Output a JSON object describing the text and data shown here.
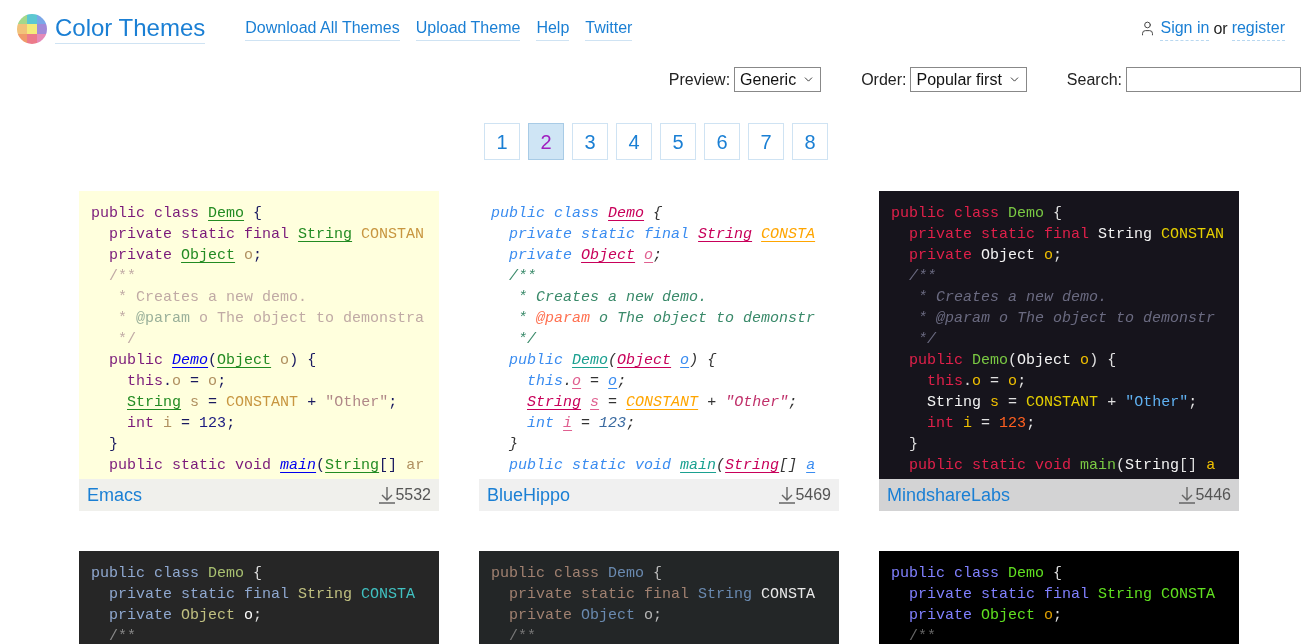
{
  "site": {
    "title": "Color Themes"
  },
  "nav": [
    "Download All Themes",
    "Upload Theme",
    "Help",
    "Twitter"
  ],
  "account": {
    "sign_in": "Sign in",
    "separator": "or",
    "register": "register"
  },
  "filters": [
    {
      "kind": "select",
      "label": "Preview:",
      "value": "Generic"
    },
    {
      "kind": "select",
      "label": "Order:",
      "value": "Popular first"
    },
    {
      "kind": "search",
      "label": "Search:"
    }
  ],
  "pages": [
    {
      "label": "1",
      "selected": false
    },
    {
      "label": "2",
      "selected": true
    },
    {
      "label": "3",
      "selected": false
    },
    {
      "label": "4",
      "selected": false
    },
    {
      "label": "5",
      "selected": false
    },
    {
      "label": "6",
      "selected": false
    },
    {
      "label": "7",
      "selected": false
    },
    {
      "label": "8",
      "selected": false
    }
  ],
  "cards": [
    {
      "kind": "emacs",
      "name": "Emacs",
      "downloads": "5532",
      "lines": [
        [
          {
            "text": "public class ",
            "kind": "kw"
          },
          {
            "text": "Demo",
            "kind": "cls"
          },
          {
            "text": " {",
            "kind": "punct"
          }
        ],
        [
          {
            "text": "  private static final ",
            "kind": "kw"
          },
          {
            "text": "String",
            "kind": "type"
          },
          {
            "text": " CONSTAN",
            "kind": "const"
          }
        ],
        [
          {
            "text": "  private ",
            "kind": "kw"
          },
          {
            "text": "Object",
            "kind": "type"
          },
          {
            "text": " o",
            "kind": "var"
          },
          {
            "text": ";",
            "kind": "punct"
          }
        ],
        [
          {
            "text": "  /**",
            "kind": "comment"
          }
        ],
        [
          {
            "text": "   * Creates a new demo.",
            "kind": "comment"
          }
        ],
        [
          {
            "text": "   * ",
            "kind": "comment"
          },
          {
            "text": "@param",
            "kind": "tag"
          },
          {
            "text": " o The object to demonstra",
            "kind": "comment"
          }
        ],
        [
          {
            "text": "   */",
            "kind": "comment"
          }
        ],
        [
          {
            "text": "  public ",
            "kind": "kw"
          },
          {
            "text": "Demo",
            "kind": "fn"
          },
          {
            "text": "(",
            "kind": "punct"
          },
          {
            "text": "Object",
            "kind": "type"
          },
          {
            "text": " o",
            "kind": "var"
          },
          {
            "text": ") {",
            "kind": "punct"
          }
        ],
        [
          {
            "text": "    this",
            "kind": "kw"
          },
          {
            "text": ".",
            "kind": "punct"
          },
          {
            "text": "o",
            "kind": "var"
          },
          {
            "text": " = ",
            "kind": "punct"
          },
          {
            "text": "o",
            "kind": "var"
          },
          {
            "text": ";",
            "kind": "punct"
          }
        ],
        [
          {
            "text": "    String",
            "kind": "type"
          },
          {
            "text": " s",
            "kind": "var"
          },
          {
            "text": " = ",
            "kind": "punct"
          },
          {
            "text": "CONSTANT",
            "kind": "const"
          },
          {
            "text": " + ",
            "kind": "punct"
          },
          {
            "text": "\"Other\"",
            "kind": "str"
          },
          {
            "text": ";",
            "kind": "punct"
          }
        ],
        [
          {
            "text": "    int",
            "kind": "kw"
          },
          {
            "text": " i",
            "kind": "var"
          },
          {
            "text": " = ",
            "kind": "punct"
          },
          {
            "text": "123",
            "kind": "num"
          },
          {
            "text": ";",
            "kind": "punct"
          }
        ],
        [
          {
            "text": "  }",
            "kind": "punct"
          }
        ],
        [
          {
            "text": "  public static void ",
            "kind": "kw"
          },
          {
            "text": "main",
            "kind": "fn"
          },
          {
            "text": "(",
            "kind": "punct"
          },
          {
            "text": "String",
            "kind": "type"
          },
          {
            "text": "[] ",
            "kind": "punct"
          },
          {
            "text": "ar",
            "kind": "var"
          }
        ]
      ]
    },
    {
      "kind": "bluehippo",
      "name": "BlueHippo",
      "downloads": "5469",
      "lines": [
        [
          {
            "text": "public class ",
            "kind": "kw"
          },
          {
            "text": "Demo",
            "kind": "cls"
          },
          {
            "text": " {",
            "kind": "punct"
          }
        ],
        [
          {
            "text": "  private static final ",
            "kind": "kw"
          },
          {
            "text": "String",
            "kind": "type"
          },
          {
            "text": " CONSTA",
            "kind": "const"
          }
        ],
        [
          {
            "text": "  private ",
            "kind": "kw"
          },
          {
            "text": "Object",
            "kind": "type"
          },
          {
            "text": " o",
            "kind": "var"
          },
          {
            "text": ";",
            "kind": "punct"
          }
        ],
        [
          {
            "text": "  /**",
            "kind": "comment"
          }
        ],
        [
          {
            "text": "   * Creates a new demo.",
            "kind": "comment"
          }
        ],
        [
          {
            "text": "   * ",
            "kind": "comment"
          },
          {
            "text": "@param",
            "kind": "tag"
          },
          {
            "text": " o The object to demonstr",
            "kind": "comment"
          }
        ],
        [
          {
            "text": "   */",
            "kind": "comment"
          }
        ],
        [
          {
            "text": "  public ",
            "kind": "kw"
          },
          {
            "text": "Demo",
            "kind": "fn"
          },
          {
            "text": "(",
            "kind": "punct"
          },
          {
            "text": "Object",
            "kind": "type"
          },
          {
            "text": " o",
            "kind": "param"
          },
          {
            "text": ") {",
            "kind": "punct"
          }
        ],
        [
          {
            "text": "    this",
            "kind": "kw"
          },
          {
            "text": ".",
            "kind": "punct"
          },
          {
            "text": "o",
            "kind": "var"
          },
          {
            "text": " = ",
            "kind": "punct"
          },
          {
            "text": "o",
            "kind": "param"
          },
          {
            "text": ";",
            "kind": "punct"
          }
        ],
        [
          {
            "text": "    String",
            "kind": "type"
          },
          {
            "text": " s",
            "kind": "var"
          },
          {
            "text": " = ",
            "kind": "punct"
          },
          {
            "text": "CONSTANT",
            "kind": "const"
          },
          {
            "text": " + ",
            "kind": "punct"
          },
          {
            "text": "\"Other\"",
            "kind": "str"
          },
          {
            "text": ";",
            "kind": "punct"
          }
        ],
        [
          {
            "text": "    int",
            "kind": "kw"
          },
          {
            "text": " i",
            "kind": "var"
          },
          {
            "text": " = ",
            "kind": "punct"
          },
          {
            "text": "123",
            "kind": "num"
          },
          {
            "text": ";",
            "kind": "punct"
          }
        ],
        [
          {
            "text": "  }",
            "kind": "punct"
          }
        ],
        [
          {
            "text": "  public static void ",
            "kind": "kw"
          },
          {
            "text": "main",
            "kind": "fn"
          },
          {
            "text": "(",
            "kind": "punct"
          },
          {
            "text": "String",
            "kind": "type"
          },
          {
            "text": "[] ",
            "kind": "punct"
          },
          {
            "text": "a",
            "kind": "param"
          }
        ]
      ]
    },
    {
      "kind": "mindshare",
      "name": "MindshareLabs",
      "downloads": "5446",
      "lines": [
        [
          {
            "text": "public class ",
            "kind": "kw"
          },
          {
            "text": "Demo",
            "kind": "cls"
          },
          {
            "text": " {",
            "kind": "punct"
          }
        ],
        [
          {
            "text": "  private static final ",
            "kind": "kw"
          },
          {
            "text": "String",
            "kind": "type"
          },
          {
            "text": " CONSTAN",
            "kind": "const"
          }
        ],
        [
          {
            "text": "  private ",
            "kind": "kw"
          },
          {
            "text": "Object",
            "kind": "type"
          },
          {
            "text": " o",
            "kind": "var"
          },
          {
            "text": ";",
            "kind": "punct"
          }
        ],
        [
          {
            "text": "  /**",
            "kind": "comment"
          }
        ],
        [
          {
            "text": "   * Creates a new demo.",
            "kind": "comment"
          }
        ],
        [
          {
            "text": "   * ",
            "kind": "comment"
          },
          {
            "text": "@param",
            "kind": "tag"
          },
          {
            "text": " o The object to demonstr",
            "kind": "comment"
          }
        ],
        [
          {
            "text": "   */",
            "kind": "comment"
          }
        ],
        [
          {
            "text": "  public ",
            "kind": "kw"
          },
          {
            "text": "Demo",
            "kind": "fn"
          },
          {
            "text": "(",
            "kind": "punct"
          },
          {
            "text": "Object",
            "kind": "type"
          },
          {
            "text": " o",
            "kind": "var"
          },
          {
            "text": ") {",
            "kind": "punct"
          }
        ],
        [
          {
            "text": "    this",
            "kind": "kw"
          },
          {
            "text": ".",
            "kind": "punct"
          },
          {
            "text": "o",
            "kind": "var"
          },
          {
            "text": " = ",
            "kind": "punct"
          },
          {
            "text": "o",
            "kind": "var"
          },
          {
            "text": ";",
            "kind": "punct"
          }
        ],
        [
          {
            "text": "    String",
            "kind": "type"
          },
          {
            "text": " s",
            "kind": "var"
          },
          {
            "text": " = ",
            "kind": "punct"
          },
          {
            "text": "CONSTANT",
            "kind": "const"
          },
          {
            "text": " + ",
            "kind": "punct"
          },
          {
            "text": "\"Other\"",
            "kind": "str"
          },
          {
            "text": ";",
            "kind": "punct"
          }
        ],
        [
          {
            "text": "    int",
            "kind": "kw"
          },
          {
            "text": " i",
            "kind": "var"
          },
          {
            "text": " = ",
            "kind": "punct"
          },
          {
            "text": "123",
            "kind": "num"
          },
          {
            "text": ";",
            "kind": "punct"
          }
        ],
        [
          {
            "text": "  }",
            "kind": "punct"
          }
        ],
        [
          {
            "text": "  public static void ",
            "kind": "kw"
          },
          {
            "text": "main",
            "kind": "fn"
          },
          {
            "text": "(",
            "kind": "punct"
          },
          {
            "text": "String",
            "kind": "type"
          },
          {
            "text": "[] ",
            "kind": "punct"
          },
          {
            "text": "a",
            "kind": "var"
          }
        ]
      ]
    },
    {
      "kind": "charcoal",
      "lines": [
        [
          {
            "text": "public class ",
            "kind": "kw"
          },
          {
            "text": "Demo",
            "kind": "cls"
          },
          {
            "text": " {",
            "kind": "punct"
          }
        ],
        [
          {
            "text": "  private static final ",
            "kind": "kw"
          },
          {
            "text": "String",
            "kind": "type"
          },
          {
            "text": " CONSTA",
            "kind": "const"
          }
        ],
        [
          {
            "text": "  private ",
            "kind": "kw"
          },
          {
            "text": "Object",
            "kind": "type"
          },
          {
            "text": " o",
            "kind": "var"
          },
          {
            "text": ";",
            "kind": "punct"
          }
        ],
        [
          {
            "text": "  /**",
            "kind": "comment"
          }
        ]
      ]
    },
    {
      "kind": "slate",
      "lines": [
        [
          {
            "text": "public class ",
            "kind": "kw"
          },
          {
            "text": "Demo",
            "kind": "cls"
          },
          {
            "text": " {",
            "kind": "punct"
          }
        ],
        [
          {
            "text": "  private static final ",
            "kind": "kw"
          },
          {
            "text": "String",
            "kind": "type"
          },
          {
            "text": " CONSTA",
            "kind": "const"
          }
        ],
        [
          {
            "text": "  private ",
            "kind": "kw"
          },
          {
            "text": "Object",
            "kind": "type"
          },
          {
            "text": " o",
            "kind": "var"
          },
          {
            "text": ";",
            "kind": "punct"
          }
        ],
        [
          {
            "text": "  /**",
            "kind": "comment"
          }
        ]
      ]
    },
    {
      "kind": "black",
      "lines": [
        [
          {
            "text": "public class ",
            "kind": "kw"
          },
          {
            "text": "Demo",
            "kind": "cls"
          },
          {
            "text": " {",
            "kind": "punct"
          }
        ],
        [
          {
            "text": "  private static final ",
            "kind": "kw"
          },
          {
            "text": "String",
            "kind": "type"
          },
          {
            "text": " CONSTA",
            "kind": "const"
          }
        ],
        [
          {
            "text": "  private ",
            "kind": "kw"
          },
          {
            "text": "Object",
            "kind": "type"
          },
          {
            "text": " o",
            "kind": "var"
          },
          {
            "text": ";",
            "kind": "punct"
          }
        ],
        [
          {
            "text": "  /**",
            "kind": "comment"
          }
        ]
      ]
    }
  ]
}
